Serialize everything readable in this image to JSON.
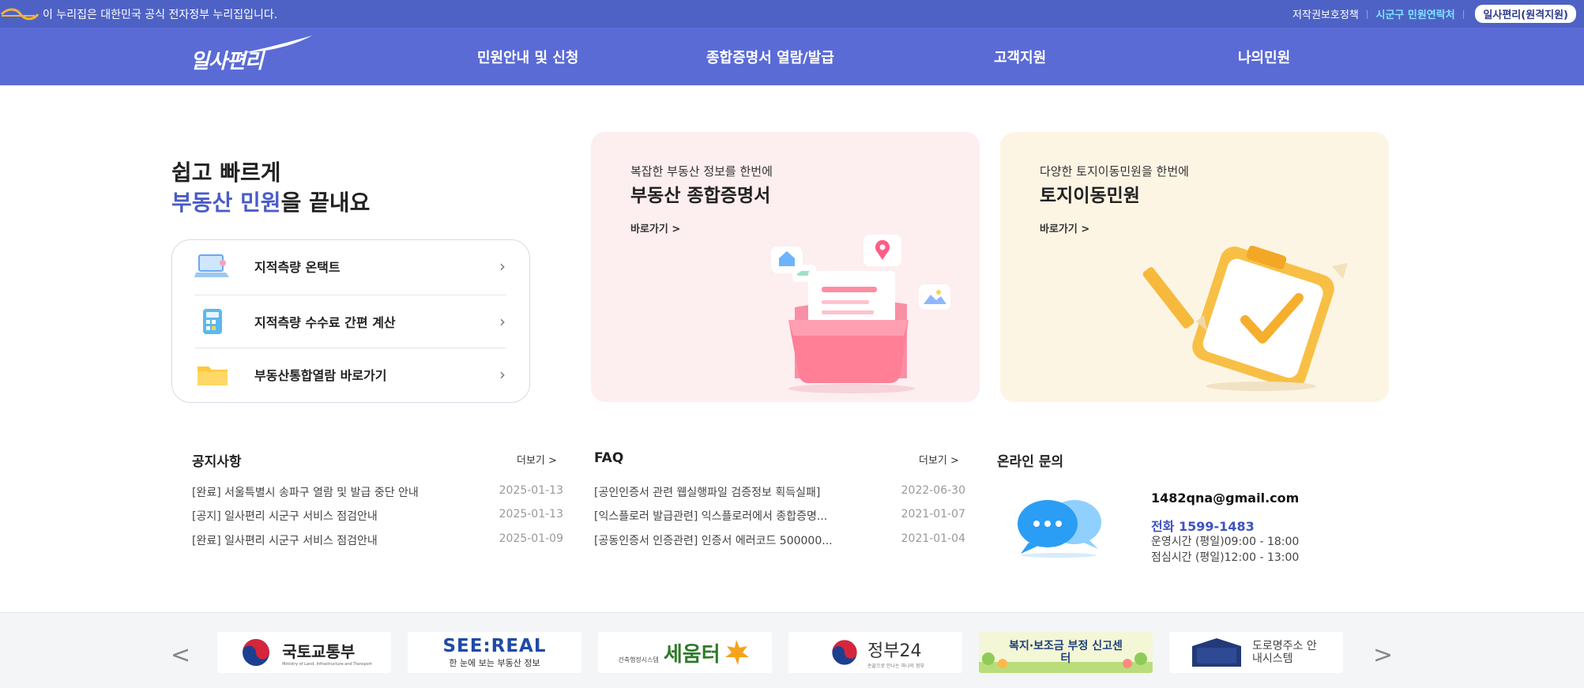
{
  "govbar": {
    "notice": "이 누리집은 대한민국 공식 전자정부 누리집입니다.",
    "links": [
      "저작권보호정책",
      "시군구 민원연락처",
      "일사편리(원격지원)"
    ]
  },
  "header": {
    "brand": "일사편리",
    "nav": [
      "민원안내 및 신청",
      "종합증명서 열람/발급",
      "고객지원",
      "나의민원"
    ]
  },
  "hero": {
    "line1": "쉽고 빠르게",
    "line2_accent": "부동산 민원",
    "line2_rest": "을 끝내요",
    "quick_links": [
      "지적측량 온택트",
      "지적측량 수수료 간편 계산",
      "부동산통합열람 바로가기"
    ]
  },
  "cards": [
    {
      "subtitle": "복잡한 부동산 정보를 한번에",
      "title": "부동산 종합증명서",
      "go": "바로가기 >"
    },
    {
      "subtitle": "다양한 토지이동민원을 한번에",
      "title": "토지이동민원",
      "go": "바로가기 >"
    }
  ],
  "notices": {
    "title": "공지사항",
    "more": "더보기 >",
    "items": [
      {
        "text": "[완료] 서울특별시 송파구 열람 및 발급 중단 안내",
        "date": "2025-01-13"
      },
      {
        "text": "[공지] 일사편리 시군구 서비스 점검안내",
        "date": "2025-01-13"
      },
      {
        "text": "[완료] 일사편리 시군구 서비스 점검안내",
        "date": "2025-01-09"
      }
    ]
  },
  "faq": {
    "title": "FAQ",
    "more": "더보기 >",
    "items": [
      {
        "text": "[공인인증서 관련 웹실행파일 검증정보 획득실패]",
        "date": "2022-06-30"
      },
      {
        "text": "[익스플로러 발급관련] 익스플로러에서 종합증명...",
        "date": "2021-01-07"
      },
      {
        "text": "[공동인증서 인증관련] 인증서 에러코드 500000...",
        "date": "2021-01-04"
      }
    ]
  },
  "inquiry": {
    "title": "온라인 문의",
    "email": "1482qna@gmail.com",
    "phone": "전화 1599-1483",
    "hours": [
      "운영시간 (평일)09:00 - 18:00",
      "점심시간 (평일)12:00 - 13:00"
    ]
  },
  "footer": {
    "prev": "<",
    "next": ">",
    "banners": [
      {
        "name": "국토교통부",
        "sub": "Ministry of Land, Infrastructure and Transport"
      },
      {
        "name": "SEE:REAL",
        "sub": "한 눈에 보는 부동산 정보"
      },
      {
        "name": "세움터",
        "sub": "건축행정시스템"
      },
      {
        "name": "정부24",
        "sub": "손끝으로 만나는 하나의 정부"
      },
      {
        "name": "복지·보조금 부정 신고센터",
        "sub": ""
      },
      {
        "name": "도로명주소 안내시스템",
        "sub": "도로명주소 안내시스템"
      }
    ]
  },
  "colors": {
    "primary": "#5a6bd6",
    "govbar": "#4e62c5",
    "accent_text": "#4a5cc8"
  }
}
